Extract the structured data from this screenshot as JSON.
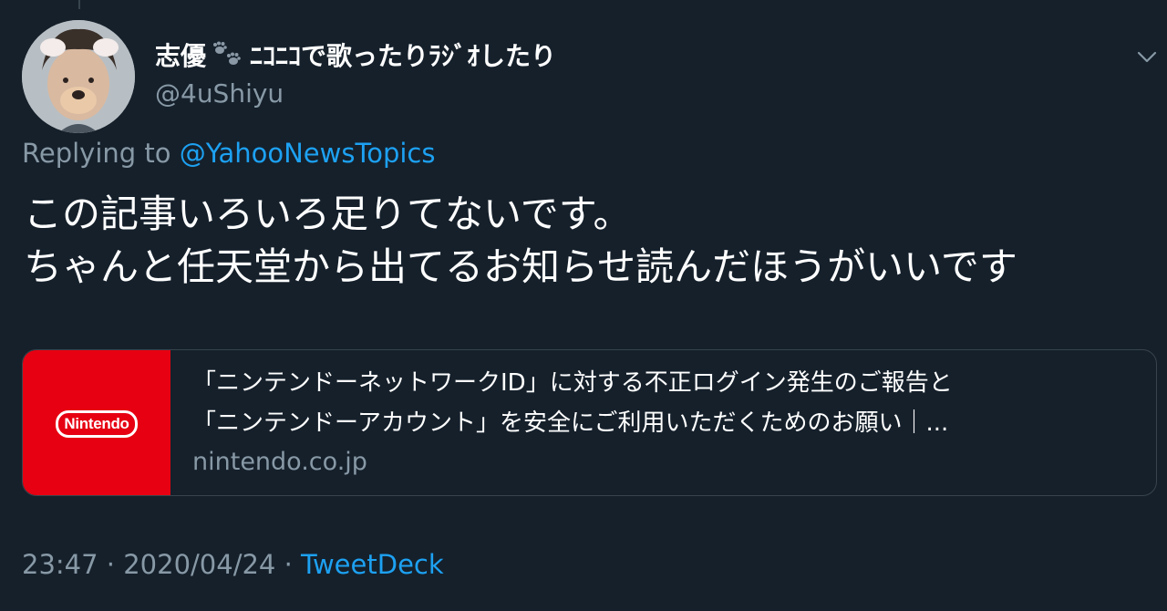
{
  "author": {
    "display_name": "志優",
    "display_name_suffix": "ﾆｺﾆｺで歌ったりﾗｼﾞｵしたり",
    "handle": "@4uShiyu",
    "avatar_icon": "user-avatar-photo",
    "name_emoji_icon": "paw-prints-icon"
  },
  "reply": {
    "prefix": "Replying to",
    "mention": "@YahooNewsTopics"
  },
  "tweet": {
    "lines": [
      "この記事いろいろ足りてないです。",
      "ちゃんと任天堂から出てるお知らせ読んだほうがいいです"
    ]
  },
  "card": {
    "title_line1": "「ニンテンドーネットワークID」に対する不正ログイン発生のご報告と",
    "title_line2": "「ニンテンドーアカウント」を安全にご利用いただくためのお願い｜...",
    "domain": "nintendo.co.jp",
    "logo_text": "Nintendo",
    "thumb_color": "#e60012"
  },
  "meta": {
    "time": "23:47",
    "separator": "·",
    "date": "2020/04/24",
    "source": "TweetDeck"
  },
  "colors": {
    "background": "#15202b",
    "primary_text": "#ffffff",
    "secondary_text": "#8899a6",
    "link": "#1da1f2",
    "border": "#38444d"
  }
}
